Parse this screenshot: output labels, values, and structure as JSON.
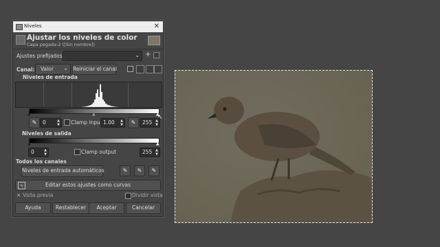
{
  "dialog": {
    "window_title": "Niveles",
    "heading": "Ajustar los niveles de color",
    "subheading": "Capa pegada-2 ([Sin nombre])"
  },
  "presets": {
    "label": "Ajustes prefijados:",
    "value": ""
  },
  "channel": {
    "label": "Canal:",
    "value": "Valor",
    "reset_label": "Reiniciar el canal"
  },
  "input_levels": {
    "title": "Niveles de entrada",
    "low": "0",
    "gamma": "1.00",
    "high": "255",
    "clamp_label": "Clamp input"
  },
  "output_levels": {
    "title": "Niveles de salida",
    "low": "0",
    "high": "255",
    "clamp_label": "Clamp output"
  },
  "all_channels": {
    "title": "Todos los canales",
    "auto_label": "Niveles de entrada automáticos"
  },
  "curves_button": "Editar estos ajustes como curvas",
  "preview": {
    "label": "Vista previa",
    "checked": true,
    "checkmark": "×"
  },
  "split_view": {
    "label": "Dividir vista",
    "checked": false
  },
  "footer": {
    "help": "Ayuda",
    "reset": "Restablecer",
    "ok": "Aceptar",
    "cancel": "Cancelar"
  },
  "icons": {
    "close": "close-icon",
    "add": "plus-icon",
    "manage": "manage-presets-icon",
    "dropdown": "chevron-down-icon"
  },
  "histogram": {
    "bins": [
      1,
      1,
      2,
      3,
      4,
      6,
      8,
      12,
      18,
      30,
      55,
      70,
      40,
      90,
      60,
      30,
      22,
      14,
      10,
      8,
      6,
      4,
      3,
      2,
      1,
      1
    ]
  }
}
